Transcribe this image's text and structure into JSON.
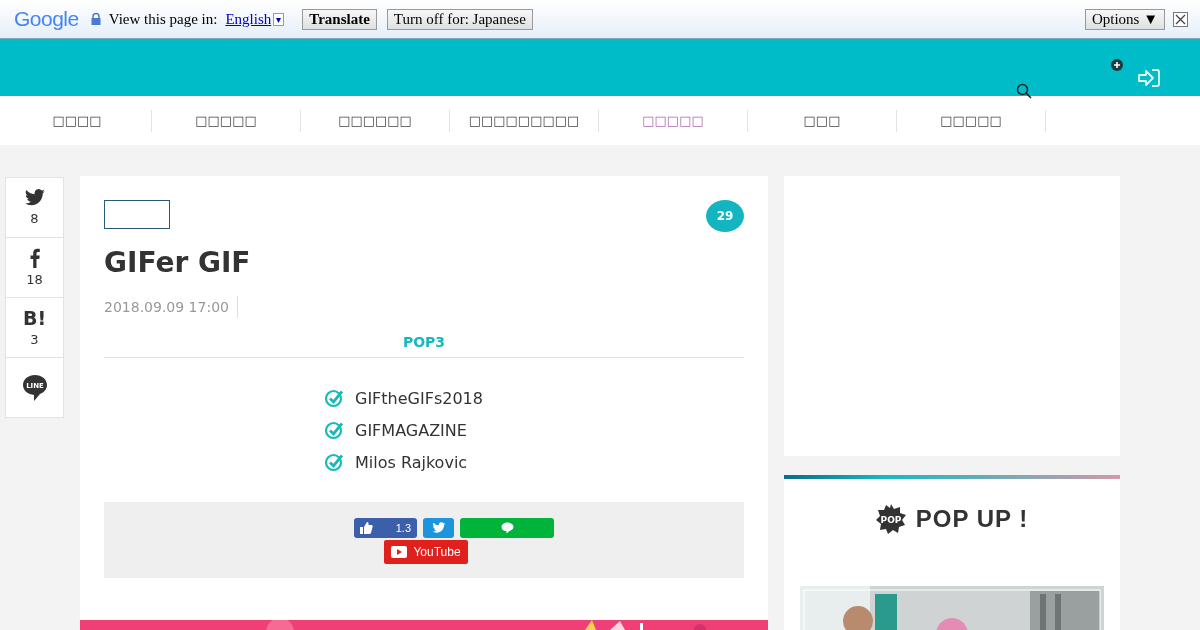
{
  "translate_bar": {
    "logo": "Google",
    "dropdown": "▾",
    "prompt": "View this page in:",
    "language": "English",
    "translate_button": "Translate",
    "turn_off_button": "Turn off for: Japanese",
    "options_button": "Options ▼"
  },
  "nav": [
    {
      "label": "□□□□",
      "selected": false
    },
    {
      "label": "□□□□□",
      "selected": false
    },
    {
      "label": "□□□□□□",
      "selected": false
    },
    {
      "label": "□□□□□□□□□",
      "selected": false
    },
    {
      "label": "□□□□□",
      "selected": true
    },
    {
      "label": "□□□",
      "selected": false
    },
    {
      "label": "□□□□□",
      "selected": false
    }
  ],
  "share": [
    {
      "kind": "twitter",
      "count": "8"
    },
    {
      "kind": "facebook",
      "count": "18"
    },
    {
      "kind": "hatena",
      "label": "B!",
      "count": "3"
    },
    {
      "kind": "line",
      "label": "LINE"
    }
  ],
  "article": {
    "comment_count": "29",
    "title": "GIFer GIF",
    "date": "2018.09.09 17:00",
    "section_title": "POP3",
    "points": [
      "GIFtheGIFs2018",
      "GIFMAGAZINE",
      "Milos Rajkovic"
    ],
    "like_count": "1.3",
    "youtube": "YouTube"
  },
  "sidebar": {
    "title": "POP UP !",
    "badge": "POP"
  }
}
